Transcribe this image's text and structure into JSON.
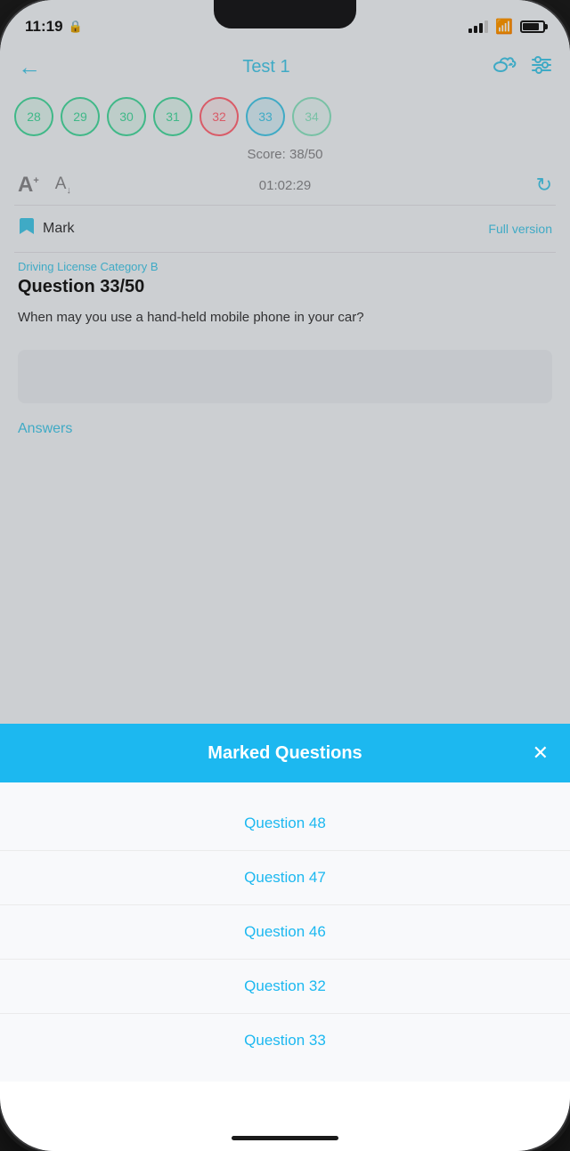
{
  "statusBar": {
    "time": "11:19",
    "lockIcon": "🔒"
  },
  "header": {
    "backLabel": "←",
    "title": "Test 1",
    "cloudIconLabel": "☁",
    "filterIconLabel": "⚙"
  },
  "questionBubbles": [
    {
      "number": "28",
      "state": "correct"
    },
    {
      "number": "29",
      "state": "correct"
    },
    {
      "number": "30",
      "state": "correct"
    },
    {
      "number": "31",
      "state": "correct"
    },
    {
      "number": "32",
      "state": "incorrect"
    },
    {
      "number": "33",
      "state": "active"
    },
    {
      "number": "34",
      "state": "correct"
    }
  ],
  "score": {
    "label": "Score: 38/50"
  },
  "fontControls": {
    "increaseLabel": "A",
    "decreaseLabel": "A",
    "timer": "01:02:29",
    "refreshIconLabel": "↺"
  },
  "markRow": {
    "bookmarkIconLabel": "🔖",
    "markLabel": "Mark",
    "fullVersionLabel": "Full version"
  },
  "question": {
    "category": "Driving License Category B",
    "numberLabel": "Question 33/50",
    "text": "When may you use a hand-held mobile phone in your car?"
  },
  "answers": {
    "label": "Answers"
  },
  "modal": {
    "title": "Marked Questions",
    "closeLabel": "✕",
    "items": [
      {
        "label": "Question 48"
      },
      {
        "label": "Question 47"
      },
      {
        "label": "Question 46"
      },
      {
        "label": "Question 32"
      },
      {
        "label": "Question 33"
      }
    ]
  }
}
